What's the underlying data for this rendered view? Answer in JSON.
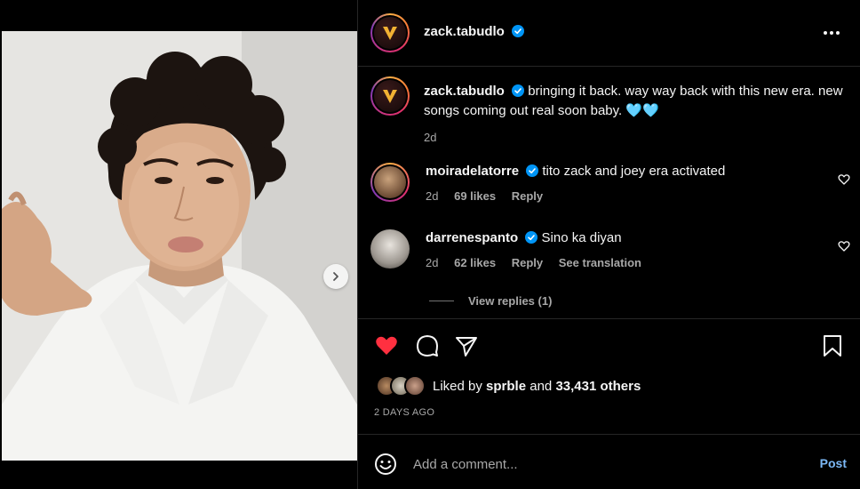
{
  "post": {
    "author": "zack.tabudlo",
    "caption": "bringing it back. way way back with this new era. new songs coming out real soon baby. 🩵🩵",
    "age": "2d",
    "liked_by": "sprble",
    "others_count": "33,431 others",
    "liked_by_prefix": "Liked by",
    "liked_by_and": "and",
    "timestamp": "2 DAYS AGO"
  },
  "comments": [
    {
      "user": "moiradelatorre",
      "text": "tito zack and joey era activated",
      "age": "2d",
      "likes": "69 likes",
      "reply_label": "Reply"
    },
    {
      "user": "darrenespanto",
      "text": "Sino ka diyan",
      "age": "2d",
      "likes": "62 likes",
      "reply_label": "Reply",
      "translation_label": "See translation"
    }
  ],
  "view_replies": "View replies (1)",
  "comment_bar": {
    "placeholder": "Add a comment...",
    "post_label": "Post"
  },
  "icons": {
    "more": "more-horizontal-icon",
    "verified": "verified-badge-icon",
    "like": "heart-filled-icon",
    "comment": "comment-icon",
    "share": "share-icon",
    "save": "bookmark-icon",
    "emoji": "emoji-icon",
    "next": "chevron-right-icon"
  },
  "colors": {
    "background": "#000000",
    "like_red": "#ff3040",
    "verified_blue": "#0095f6",
    "post_blue": "#7cb8f5",
    "secondary_text": "#a8a8a8"
  }
}
